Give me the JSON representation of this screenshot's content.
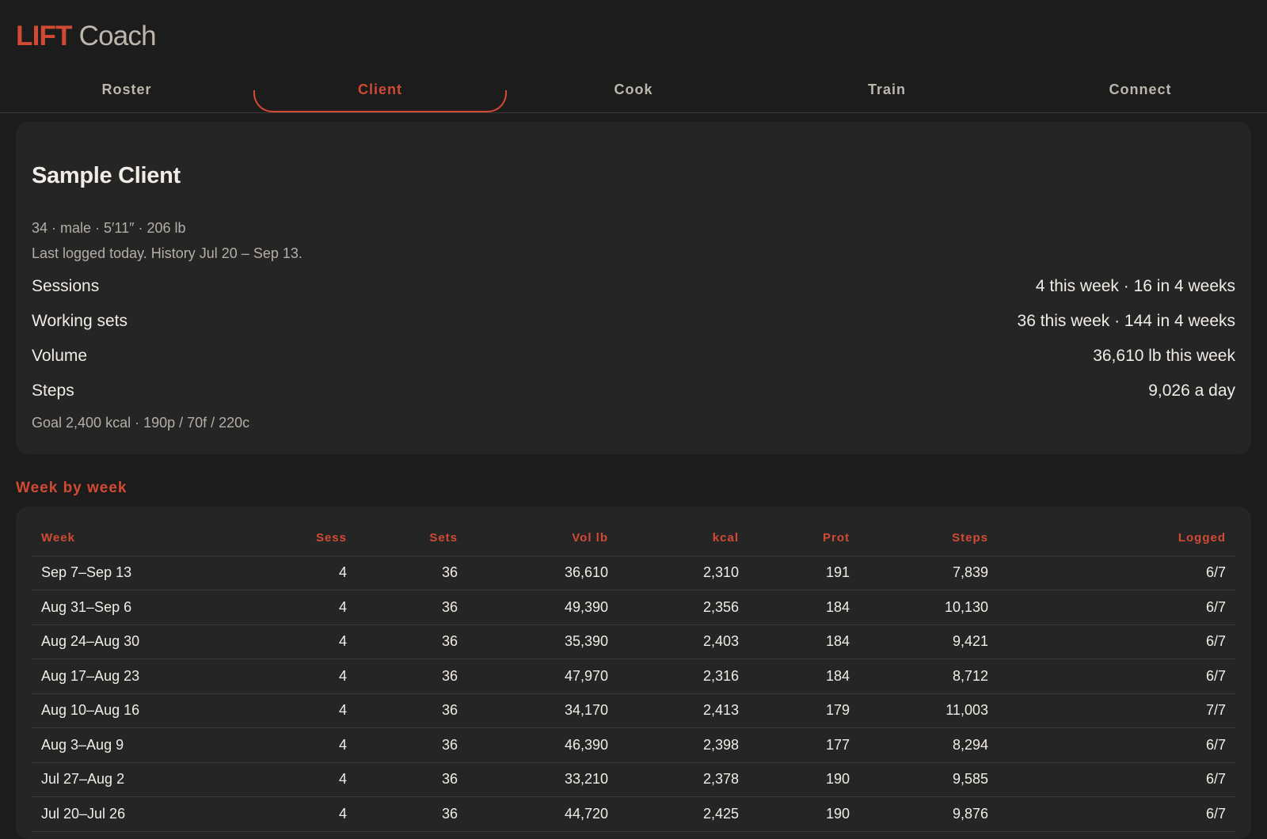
{
  "header": {
    "brand": "LIFT",
    "product": "Coach"
  },
  "tabs": [
    {
      "label": "Roster",
      "active": false
    },
    {
      "label": "Client",
      "active": true
    },
    {
      "label": "Cook",
      "active": false
    },
    {
      "label": "Train",
      "active": false
    },
    {
      "label": "Connect",
      "active": false
    }
  ],
  "client": {
    "name": "Sample Client",
    "demographics": "34 · male · 5′11″ · 206 lb",
    "history": "Last logged today. History Jul 20 – Sep 13.",
    "stats": [
      {
        "label": "Sessions",
        "value": "4 this week · 16 in 4 weeks"
      },
      {
        "label": "Working sets",
        "value": "36 this week · 144 in 4 weeks"
      },
      {
        "label": "Volume",
        "value": "36,610 lb this week"
      },
      {
        "label": "Steps",
        "value": "9,026 a day"
      }
    ],
    "goal": "Goal 2,400 kcal · 190p / 70f / 220c"
  },
  "weekly": {
    "title": "Week by week",
    "columns": [
      "Week",
      "Sess",
      "Sets",
      "Vol lb",
      "kcal",
      "Prot",
      "Steps",
      "Logged"
    ],
    "rows": [
      [
        "Sep 7–Sep 13",
        "4",
        "36",
        "36,610",
        "2,310",
        "191",
        "7,839",
        "6/7"
      ],
      [
        "Aug 31–Sep 6",
        "4",
        "36",
        "49,390",
        "2,356",
        "184",
        "10,130",
        "6/7"
      ],
      [
        "Aug 24–Aug 30",
        "4",
        "36",
        "35,390",
        "2,403",
        "184",
        "9,421",
        "6/7"
      ],
      [
        "Aug 17–Aug 23",
        "4",
        "36",
        "47,970",
        "2,316",
        "184",
        "8,712",
        "6/7"
      ],
      [
        "Aug 10–Aug 16",
        "4",
        "36",
        "34,170",
        "2,413",
        "179",
        "11,003",
        "7/7"
      ],
      [
        "Aug 3–Aug 9",
        "4",
        "36",
        "46,390",
        "2,398",
        "177",
        "8,294",
        "6/7"
      ],
      [
        "Jul 27–Aug 2",
        "4",
        "36",
        "33,210",
        "2,378",
        "190",
        "9,585",
        "6/7"
      ],
      [
        "Jul 20–Jul 26",
        "4",
        "36",
        "44,720",
        "2,425",
        "190",
        "9,876",
        "6/7"
      ]
    ]
  },
  "colors": {
    "accent": "#d24a34",
    "background": "#1c1c1c",
    "card": "#252525"
  }
}
